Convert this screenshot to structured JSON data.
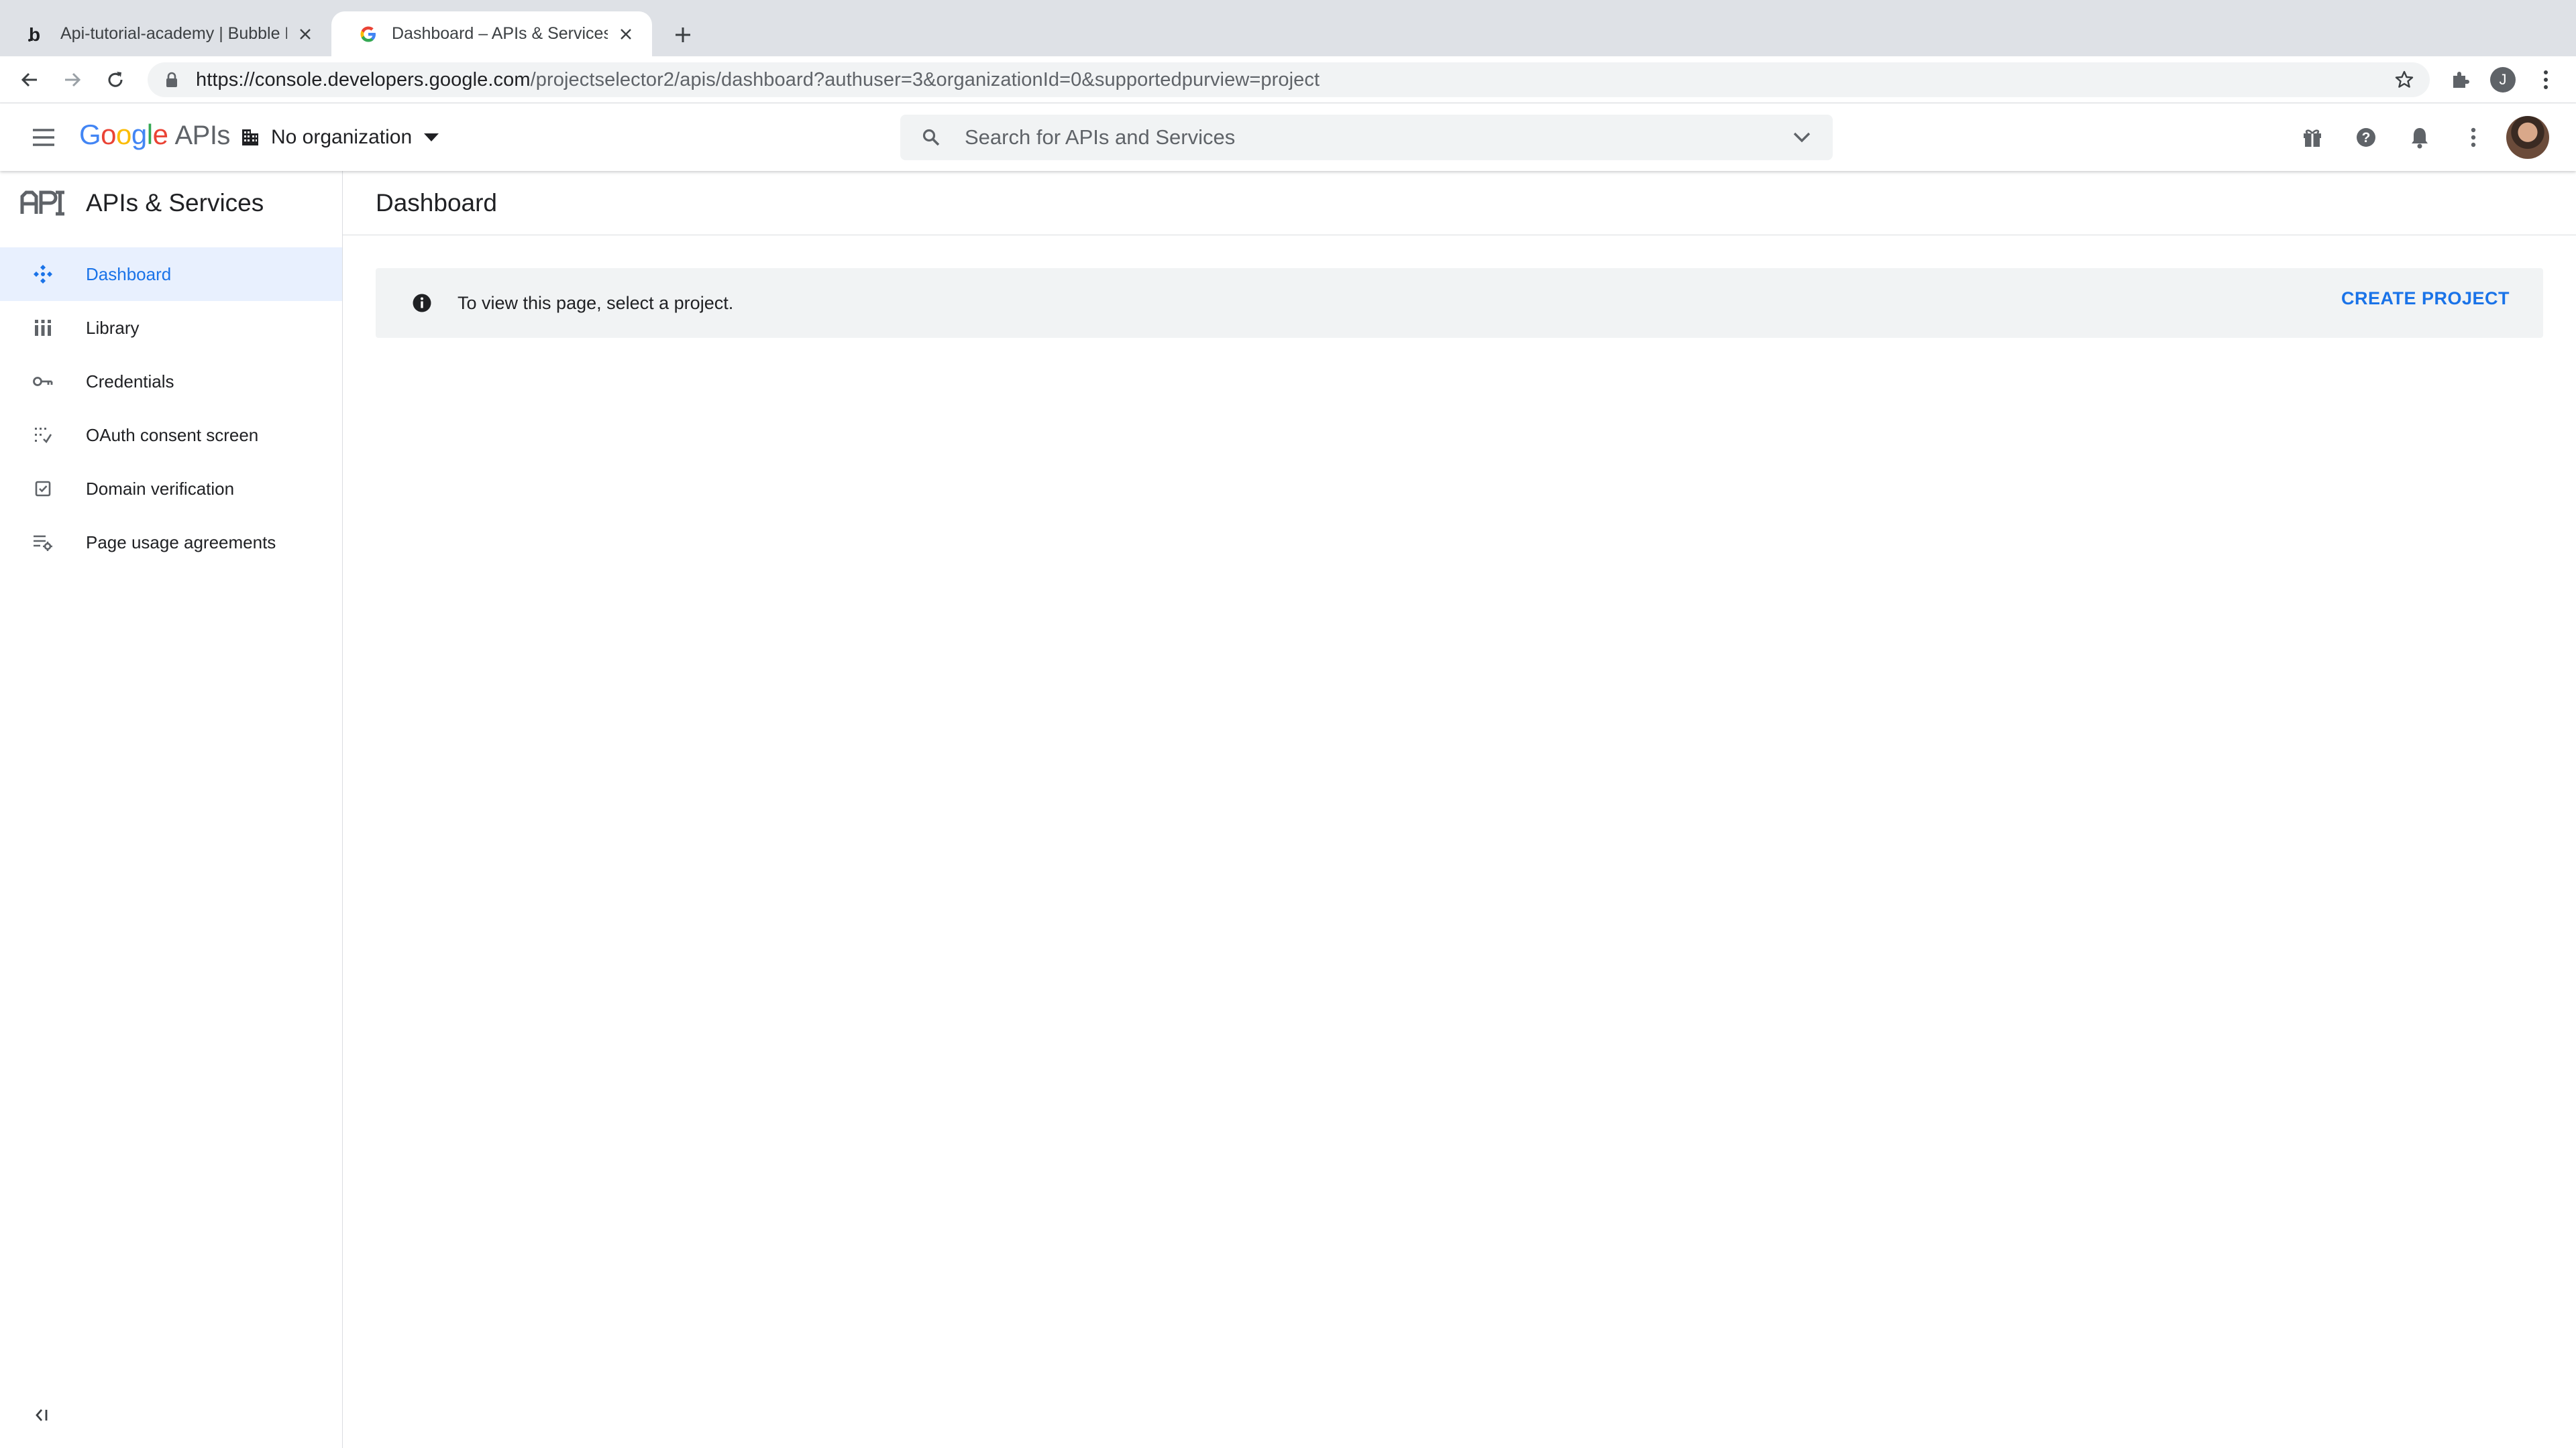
{
  "browser": {
    "tabs": [
      {
        "title": "Api-tutorial-academy | Bubble Editor",
        "favicon": "bubble-logo-icon",
        "active": false
      },
      {
        "title": "Dashboard – APIs & Services – Google Cloud Platform",
        "favicon": "google-g-icon",
        "active": true
      }
    ],
    "url_host": "https://console.developers.google.com",
    "url_path": "/projectselector2/apis/dashboard?authuser=3&organizationId=0&supportedpurview=project",
    "profile_initial": "J"
  },
  "header": {
    "logo_google": "Google",
    "logo_apis": "APIs",
    "organization": "No organization",
    "search_placeholder": "Search for APIs and Services"
  },
  "sidebar": {
    "title": "APIs & Services",
    "items": [
      {
        "label": "Dashboard",
        "icon": "dashboard-icon",
        "active": true
      },
      {
        "label": "Library",
        "icon": "library-icon",
        "active": false
      },
      {
        "label": "Credentials",
        "icon": "key-icon",
        "active": false
      },
      {
        "label": "OAuth consent screen",
        "icon": "consent-icon",
        "active": false
      },
      {
        "label": "Domain verification",
        "icon": "checkbox-icon",
        "active": false
      },
      {
        "label": "Page usage agreements",
        "icon": "settings-list-icon",
        "active": false
      }
    ]
  },
  "main": {
    "page_title": "Dashboard",
    "banner_message": "To view this page, select a project.",
    "banner_action": "CREATE PROJECT"
  },
  "colors": {
    "accent": "#1a73e8",
    "active_bg": "#e8f0fe",
    "banner_bg": "#f1f3f4",
    "tabstrip_bg": "#dee1e6"
  }
}
